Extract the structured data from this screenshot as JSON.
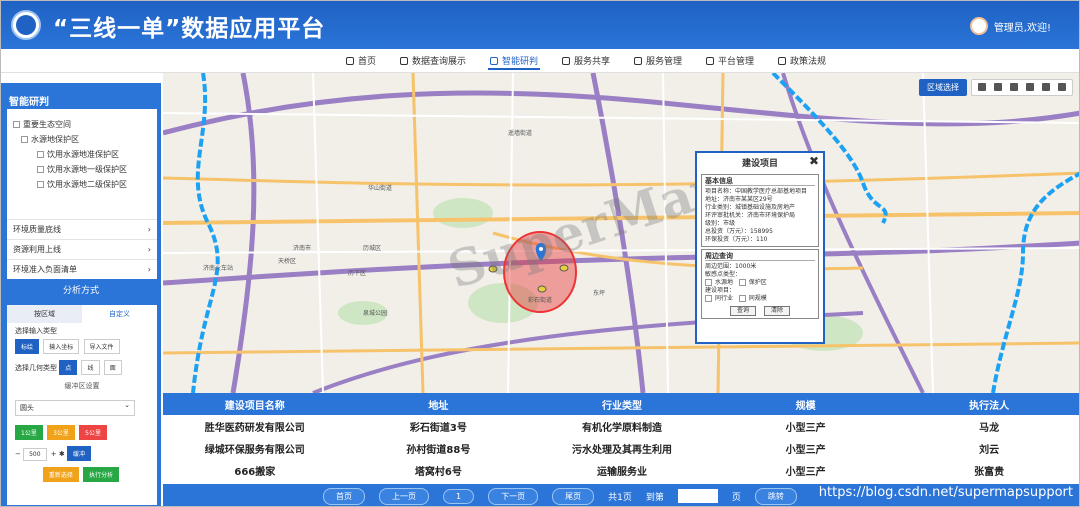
{
  "header": {
    "title": "“三线一单”数据应用平台",
    "user": "管理员,欢迎!"
  },
  "nav": [
    {
      "label": "首页"
    },
    {
      "label": "数据查询展示"
    },
    {
      "label": "智能研判"
    },
    {
      "label": "服务共享"
    },
    {
      "label": "服务管理"
    },
    {
      "label": "平台管理"
    },
    {
      "label": "政策法规"
    }
  ],
  "sidebar": {
    "title": "智能研判",
    "tree": [
      "重要生态空间",
      "水源地保护区",
      "饮用水源地准保护区",
      "饮用水源地一级保护区",
      "饮用水源地二级保护区"
    ],
    "menu": [
      "环境质量底线",
      "资源利用上线",
      "环境准入负面清单"
    ],
    "analysis_title": "分析方式",
    "tabs": [
      "按区域",
      "自定义"
    ],
    "input_type_label": "选择输入类型",
    "input_types": [
      "标绘",
      "输入坐标",
      "导入文件"
    ],
    "geom_label": "选择几何类型",
    "geom_types": [
      "点",
      "线",
      "面"
    ],
    "buffer_label": "缓冲区设置",
    "buffer_shape": "圆头",
    "buffer_sizes": [
      "1公里",
      "3公里",
      "5公里"
    ],
    "buffer_value": "500",
    "buffer_btn": "缓冲",
    "reset_btn": "重新选择",
    "run_btn": "执行分析"
  },
  "map": {
    "region_btn": "区域选择",
    "watermark": "SuperMap",
    "labels": [
      "济南火车站",
      "济南市",
      "历下区",
      "天桥区",
      "历城区",
      "泉城公园",
      "彩石街道",
      "东坪",
      "华山街道",
      "遥墙街道"
    ],
    "popup": {
      "title": "建设项目",
      "basic_title": "基本信息",
      "basic": [
        "项目名称：中国教学医疗总部基地项目",
        "地址：济南市某某区29号",
        "行业类别：城镇基础设施及房地产",
        "环评审批机关：济南市环境保护局",
        "级别：市级",
        "总投资（万元）：158995",
        "环保投资（万元）：110"
      ],
      "around_title": "周边查询",
      "around": [
        "周边范围：1000米",
        "敏感点类型：",
        "水源地",
        "保护区",
        "建设项目：",
        "同行业",
        "同规模"
      ],
      "query_btn": "查询",
      "clear_btn": "清除"
    }
  },
  "table": {
    "headers": [
      "建设项目名称",
      "地址",
      "行业类型",
      "规模",
      "执行法人"
    ],
    "rows": [
      [
        "胜华医药研发有限公司",
        "彩石街道3号",
        "有机化学原料制造",
        "小型三产",
        "马龙"
      ],
      [
        "绿城环保服务有限公司",
        "孙村街道88号",
        "污水处理及其再生利用",
        "小型三产",
        "刘云"
      ],
      [
        "666搬家",
        "塔窝村6号",
        "运输服务业",
        "小型三产",
        "张富贵"
      ]
    ],
    "pager": {
      "first": "首页",
      "prev": "上一页",
      "page": "1",
      "next": "下一页",
      "last": "尾页",
      "total": "共1页",
      "goto": "到第",
      "page_unit": "页",
      "confirm": "跳转"
    },
    "footer_url": "https://blog.csdn.net/supermapsupport"
  }
}
